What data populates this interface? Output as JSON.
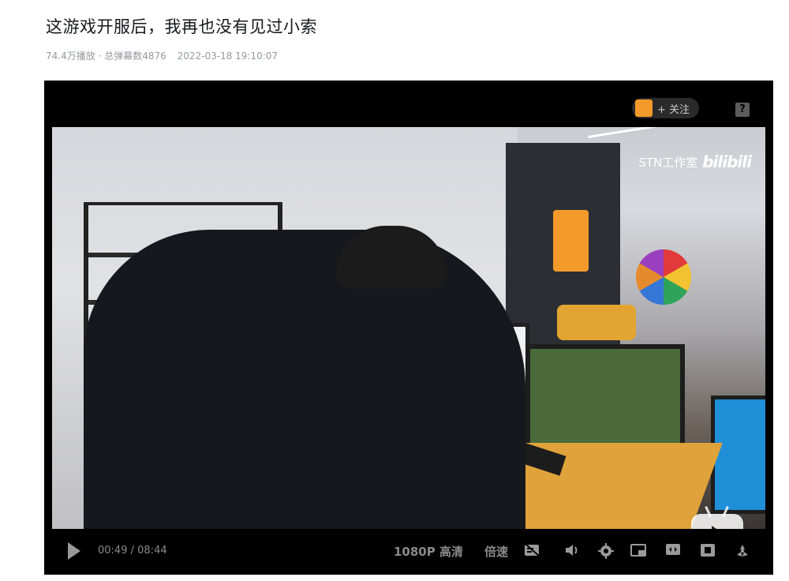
{
  "video": {
    "title": "这游戏开服后，我再也没有见过小索",
    "views": "74.4万播放",
    "separator": "·",
    "danmaku": "总弹幕数4876",
    "date": "2022-03-18 19:10:07"
  },
  "player": {
    "follow_label": "+ 关注",
    "help_label": "?",
    "watermark_text": "STN工作室",
    "watermark_brand": "bilibili",
    "current_time": "00:49",
    "time_separator": "/",
    "total_time": "08:44",
    "quality": "1080P 高清",
    "speed": "倍速",
    "icons": {
      "play": "play-icon",
      "danmaku_toggle": "danmaku-off-icon",
      "volume": "volume-icon",
      "settings": "gear-icon",
      "pip": "picture-in-picture-icon",
      "widescreen": "widescreen-icon",
      "webfullscreen": "web-fullscreen-icon",
      "fullscreen": "fullscreen-icon"
    }
  }
}
